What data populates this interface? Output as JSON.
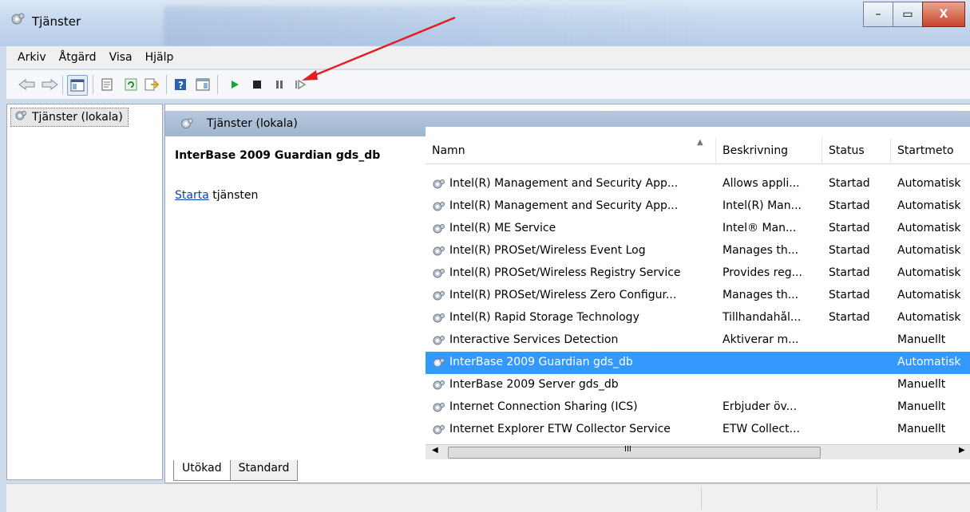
{
  "window": {
    "title": "Tjänster",
    "close": "X"
  },
  "menu": [
    "Arkiv",
    "Åtgärd",
    "Visa",
    "Hjälp"
  ],
  "tree": {
    "root": "Tjänster (lokala)"
  },
  "panel": {
    "header": "Tjänster (lokala)",
    "selected_title": "InterBase 2009 Guardian gds_db",
    "link": "Starta",
    "link_suffix": " tjänsten"
  },
  "columns": [
    "Namn",
    "Beskrivning",
    "Status",
    "Startmeto"
  ],
  "rows": [
    {
      "name": "Intel(R) Management and Security App...",
      "desc": "Allows appli...",
      "status": "Startad",
      "start": "Automatisk"
    },
    {
      "name": "Intel(R) Management and Security App...",
      "desc": "Intel(R) Man...",
      "status": "Startad",
      "start": "Automatisk"
    },
    {
      "name": "Intel(R) ME Service",
      "desc": "Intel® Man...",
      "status": "Startad",
      "start": "Automatisk"
    },
    {
      "name": "Intel(R) PROSet/Wireless Event Log",
      "desc": "Manages th...",
      "status": "Startad",
      "start": "Automatisk"
    },
    {
      "name": "Intel(R) PROSet/Wireless Registry Service",
      "desc": "Provides reg...",
      "status": "Startad",
      "start": "Automatisk"
    },
    {
      "name": "Intel(R) PROSet/Wireless Zero Configur...",
      "desc": "Manages th...",
      "status": "Startad",
      "start": "Automatisk"
    },
    {
      "name": "Intel(R) Rapid Storage Technology",
      "desc": "Tillhandahål...",
      "status": "Startad",
      "start": "Automatisk"
    },
    {
      "name": "Interactive Services Detection",
      "desc": "Aktiverar m...",
      "status": "",
      "start": "Manuellt"
    },
    {
      "name": "InterBase 2009 Guardian gds_db",
      "desc": "",
      "status": "",
      "start": "Automatisk"
    },
    {
      "name": "InterBase 2009 Server gds_db",
      "desc": "",
      "status": "",
      "start": "Manuellt"
    },
    {
      "name": "Internet Connection Sharing (ICS)",
      "desc": "Erbjuder öv...",
      "status": "",
      "start": "Manuellt"
    },
    {
      "name": "Internet Explorer ETW Collector Service",
      "desc": "ETW Collect...",
      "status": "",
      "start": "Manuellt"
    }
  ],
  "selected_row_index": 8,
  "tabs": [
    "Utökad",
    "Standard"
  ],
  "scroll": {
    "hthumb_label": "III"
  },
  "colors": {
    "selection": "#3399ff",
    "header": "#a9bdd6",
    "arrow": "#e02020",
    "play": "#1aa33a"
  },
  "icons": [
    "gears-icon",
    "back-arrow-icon",
    "forward-arrow-icon",
    "console-tree-icon",
    "properties-icon",
    "refresh-icon",
    "export-icon",
    "help-icon",
    "show-pane-icon",
    "play-icon",
    "stop-icon",
    "pause-icon",
    "resume-icon"
  ]
}
